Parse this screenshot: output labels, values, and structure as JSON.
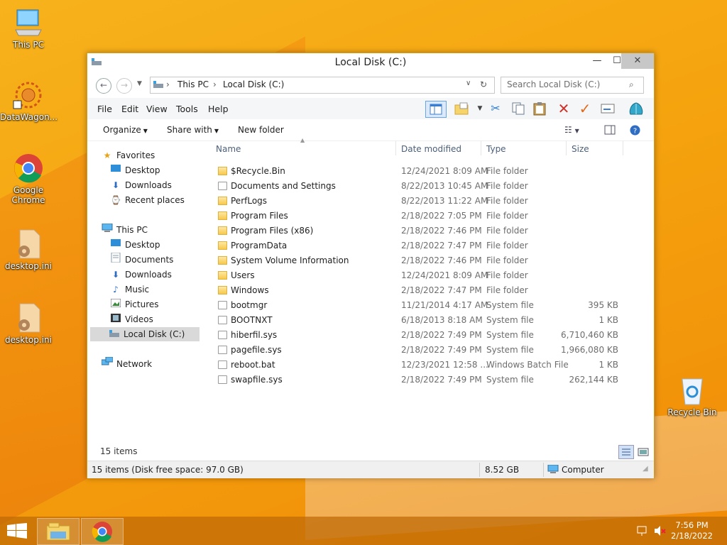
{
  "desktop": {
    "icons": [
      {
        "label": "This PC"
      },
      {
        "label": "DataWagon..."
      },
      {
        "label": "Google Chrome"
      },
      {
        "label": "desktop.ini"
      },
      {
        "label": "desktop.ini"
      },
      {
        "label": "Recycle Bin"
      }
    ]
  },
  "window": {
    "title": "Local Disk (C:)",
    "controls": {
      "minimize": "—",
      "maximize": "☐",
      "close": "✕"
    },
    "address": {
      "parts": [
        "This PC",
        "Local Disk (C:)"
      ],
      "separator": "›"
    },
    "search_placeholder": "Search Local Disk (C:)",
    "menu": [
      "File",
      "Edit",
      "View",
      "Tools",
      "Help"
    ],
    "commands": {
      "organize": "Organize",
      "share": "Share with",
      "new_folder": "New folder"
    },
    "nav": {
      "favorites": "Favorites",
      "fav_items": [
        "Desktop",
        "Downloads",
        "Recent places"
      ],
      "this_pc": "This PC",
      "pc_items": [
        "Desktop",
        "Documents",
        "Downloads",
        "Music",
        "Pictures",
        "Videos",
        "Local Disk (C:)"
      ],
      "network": "Network"
    },
    "columns": {
      "name": "Name",
      "date": "Date modified",
      "type": "Type",
      "size": "Size"
    },
    "files": [
      {
        "name": "$Recycle.Bin",
        "date": "12/24/2021 8:09 AM",
        "type": "File folder",
        "size": "",
        "kind": "folder"
      },
      {
        "name": "Documents and Settings",
        "date": "8/22/2013 10:45 AM",
        "type": "File folder",
        "size": "",
        "kind": "link"
      },
      {
        "name": "PerfLogs",
        "date": "8/22/2013 11:22 AM",
        "type": "File folder",
        "size": "",
        "kind": "folder"
      },
      {
        "name": "Program Files",
        "date": "2/18/2022 7:05 PM",
        "type": "File folder",
        "size": "",
        "kind": "folder"
      },
      {
        "name": "Program Files (x86)",
        "date": "2/18/2022 7:46 PM",
        "type": "File folder",
        "size": "",
        "kind": "folder"
      },
      {
        "name": "ProgramData",
        "date": "2/18/2022 7:47 PM",
        "type": "File folder",
        "size": "",
        "kind": "folder"
      },
      {
        "name": "System Volume Information",
        "date": "2/18/2022 7:46 PM",
        "type": "File folder",
        "size": "",
        "kind": "folder"
      },
      {
        "name": "Users",
        "date": "12/24/2021 8:09 AM",
        "type": "File folder",
        "size": "",
        "kind": "folder"
      },
      {
        "name": "Windows",
        "date": "2/18/2022 7:47 PM",
        "type": "File folder",
        "size": "",
        "kind": "folder"
      },
      {
        "name": "bootmgr",
        "date": "11/21/2014 4:17 AM",
        "type": "System file",
        "size": "395 KB",
        "kind": "file"
      },
      {
        "name": "BOOTNXT",
        "date": "6/18/2013 8:18 AM",
        "type": "System file",
        "size": "1 KB",
        "kind": "file"
      },
      {
        "name": "hiberfil.sys",
        "date": "2/18/2022 7:49 PM",
        "type": "System file",
        "size": "6,710,460 KB",
        "kind": "file"
      },
      {
        "name": "pagefile.sys",
        "date": "2/18/2022 7:49 PM",
        "type": "System file",
        "size": "1,966,080 KB",
        "kind": "file"
      },
      {
        "name": "reboot.bat",
        "date": "12/23/2021 12:58 ...",
        "type": "Windows Batch File",
        "size": "1 KB",
        "kind": "bat"
      },
      {
        "name": "swapfile.sys",
        "date": "2/18/2022 7:49 PM",
        "type": "System file",
        "size": "262,144 KB",
        "kind": "file"
      }
    ],
    "item_count": "15 items",
    "status": {
      "left": "15 items (Disk free space: 97.0 GB)",
      "size": "8.52 GB",
      "location": "Computer"
    }
  },
  "taskbar": {
    "time": "7:56 PM",
    "date": "2/18/2022"
  }
}
